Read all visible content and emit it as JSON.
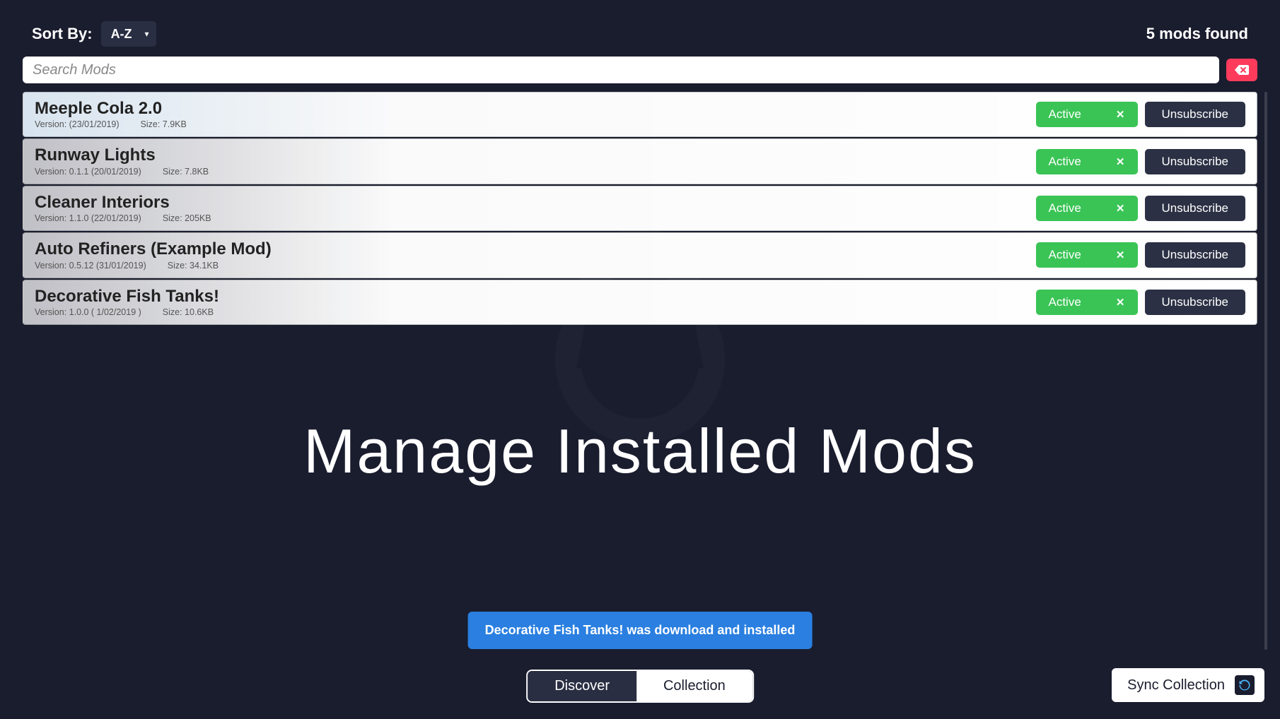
{
  "sort": {
    "label": "Sort By:",
    "value": "A-Z"
  },
  "count_text": "5 mods found",
  "search": {
    "placeholder": "Search Mods"
  },
  "buttons": {
    "active": "Active",
    "unsubscribe": "Unsubscribe"
  },
  "mods": [
    {
      "title": "Meeple Cola 2.0",
      "version": "Version:  (23/01/2019)",
      "size": "Size: 7.9KB"
    },
    {
      "title": "Runway Lights",
      "version": "Version: 0.1.1 (20/01/2019)",
      "size": "Size: 7.8KB"
    },
    {
      "title": "Cleaner Interiors",
      "version": "Version: 1.1.0 (22/01/2019)",
      "size": "Size: 205KB"
    },
    {
      "title": "Auto Refiners (Example Mod)",
      "version": "Version: 0.5.12 (31/01/2019)",
      "size": "Size: 34.1KB"
    },
    {
      "title": "Decorative Fish Tanks!",
      "version": "Version: 1.0.0 ( 1/02/2019 )",
      "size": "Size: 10.6KB"
    }
  ],
  "main_title": "Manage Installed Mods",
  "toast": "Decorative Fish Tanks! was download and installed",
  "tabs": {
    "discover": "Discover",
    "collection": "Collection"
  },
  "sync": "Sync Collection"
}
